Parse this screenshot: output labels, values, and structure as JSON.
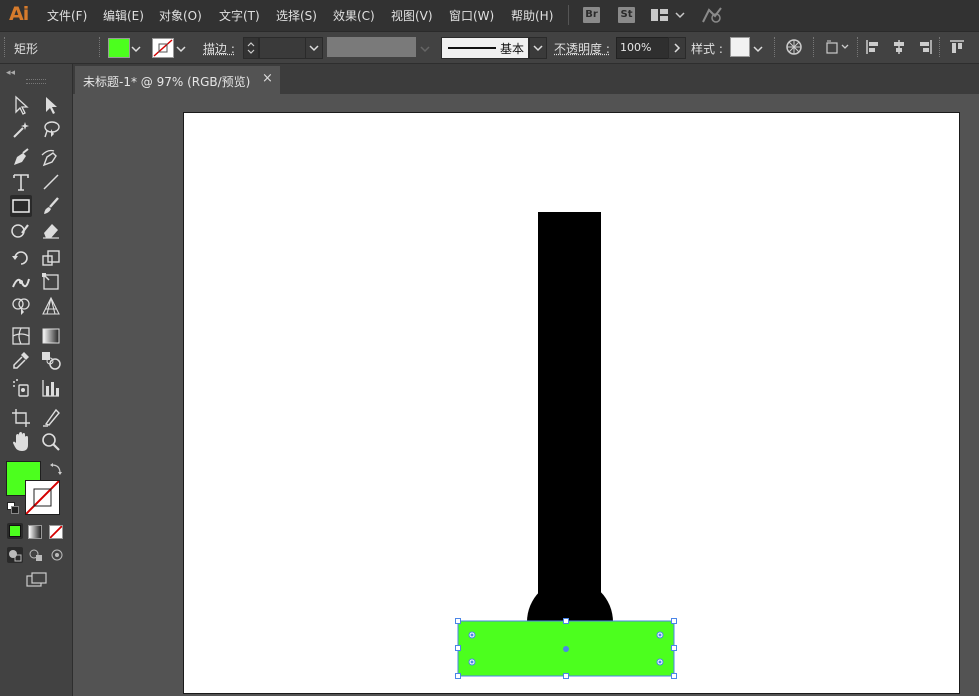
{
  "app": {
    "logo_text": "Ai"
  },
  "menu": {
    "items": [
      "文件(F)",
      "编辑(E)",
      "对象(O)",
      "文字(T)",
      "选择(S)",
      "效果(C)",
      "视图(V)",
      "窗口(W)",
      "帮助(H)"
    ],
    "bridge_badge": "Br",
    "stock_badge": "St"
  },
  "control": {
    "object_type": "矩形",
    "fill_color": "#4cff1e",
    "stroke_label": "描边 :",
    "stroke_value": "",
    "stroke_style_label": "基本",
    "opacity_label": "不透明度 :",
    "opacity_value": "100%",
    "style_label": "样式 :"
  },
  "document": {
    "tab_title": "未标题-1* @ 97% (RGB/预览)",
    "tab_close": "×"
  },
  "tools": {
    "fill_color": "#4cff1e",
    "stroke": "none"
  },
  "artwork": {
    "shapes": [
      "black-vertical-bar",
      "black-semicircle",
      "green-rectangle"
    ],
    "colors": {
      "black": "#000000",
      "green": "#4cff1e",
      "selection": "#4a86e8"
    }
  }
}
